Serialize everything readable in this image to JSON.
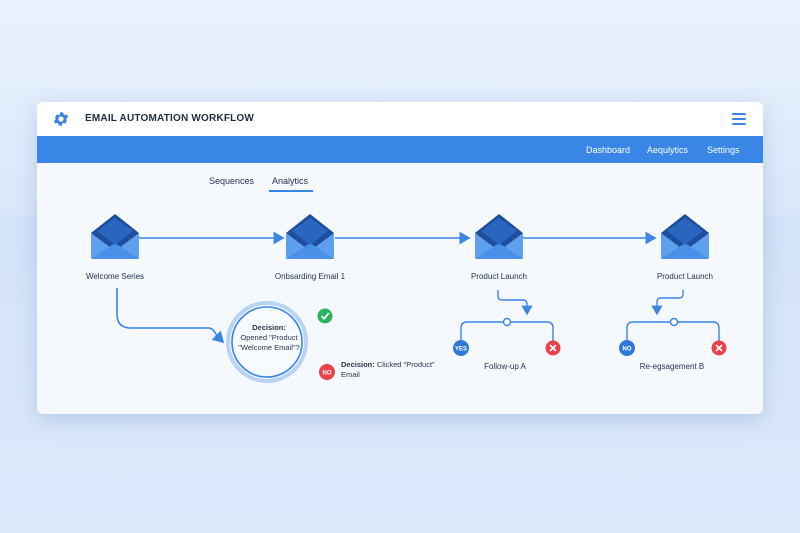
{
  "app": {
    "title": "EMAIL AUTOMATION WORKFLOW"
  },
  "nav": {
    "items": [
      "Dashboard",
      "Aequlytics",
      "Settings"
    ]
  },
  "tabs": [
    {
      "label": "Sequences",
      "active": false
    },
    {
      "label": "Analytics",
      "active": true
    }
  ],
  "nodes": [
    {
      "label": "Welcome Series"
    },
    {
      "label": "Onbsarding Email 1"
    },
    {
      "label": "Product Launch"
    },
    {
      "label": "Product Launch"
    }
  ],
  "decision1": {
    "title": "Decision:",
    "text": "Opened \"Product \"Welcome Email\"?",
    "yes_icon": "check-icon",
    "no_label": "NO"
  },
  "decision2": {
    "title": "Decision:",
    "text": "Clicked \"Product\" Email"
  },
  "branches": [
    {
      "left_label": "YES",
      "right_icon": "x-icon",
      "outcome": "Follow-up A"
    },
    {
      "left_label": "NO",
      "right_icon": "x-icon",
      "outcome": "Re-egsagement B"
    }
  ],
  "colors": {
    "accent": "#3a86e6",
    "envelope_dark": "#1f4f9c",
    "envelope_light": "#5fa0ee",
    "yes_green": "#29b35a",
    "no_red": "#e8424a"
  }
}
